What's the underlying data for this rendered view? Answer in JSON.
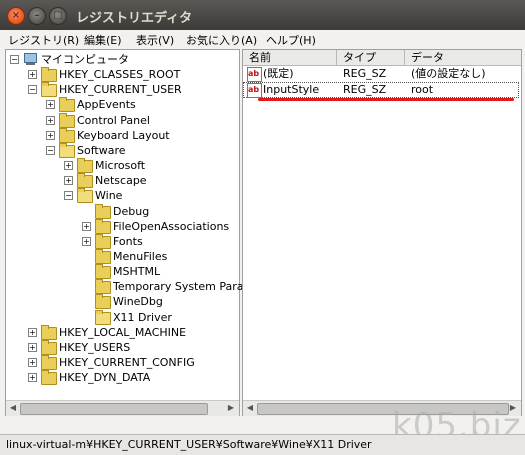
{
  "window": {
    "title": "レジストリエディタ"
  },
  "menubar": [
    "レジストリ(R)",
    "編集(E)",
    "表示(V)",
    "お気に入り(A)",
    "ヘルプ(H)"
  ],
  "tree": [
    {
      "label": "マイコンピュータ",
      "depth": 0,
      "icon": "computer-icon",
      "expander": "-"
    },
    {
      "label": "HKEY_CLASSES_ROOT",
      "depth": 1,
      "icon": "folder-icon",
      "expander": "+"
    },
    {
      "label": "HKEY_CURRENT_USER",
      "depth": 1,
      "icon": "folder-open-icon",
      "expander": "-"
    },
    {
      "label": "AppEvents",
      "depth": 2,
      "icon": "folder-icon",
      "expander": "+"
    },
    {
      "label": "Control Panel",
      "depth": 2,
      "icon": "folder-icon",
      "expander": "+"
    },
    {
      "label": "Keyboard Layout",
      "depth": 2,
      "icon": "folder-icon",
      "expander": "+"
    },
    {
      "label": "Software",
      "depth": 2,
      "icon": "folder-open-icon",
      "expander": "-"
    },
    {
      "label": "Microsoft",
      "depth": 3,
      "icon": "folder-icon",
      "expander": "+"
    },
    {
      "label": "Netscape",
      "depth": 3,
      "icon": "folder-icon",
      "expander": "+"
    },
    {
      "label": "Wine",
      "depth": 3,
      "icon": "folder-open-icon",
      "expander": "-"
    },
    {
      "label": "Debug",
      "depth": 4,
      "icon": "folder-icon",
      "expander": ""
    },
    {
      "label": "FileOpenAssociations",
      "depth": 4,
      "icon": "folder-icon",
      "expander": "+"
    },
    {
      "label": "Fonts",
      "depth": 4,
      "icon": "folder-icon",
      "expander": "+"
    },
    {
      "label": "MenuFiles",
      "depth": 4,
      "icon": "folder-icon",
      "expander": ""
    },
    {
      "label": "MSHTML",
      "depth": 4,
      "icon": "folder-icon",
      "expander": ""
    },
    {
      "label": "Temporary System Para",
      "depth": 4,
      "icon": "folder-icon",
      "expander": ""
    },
    {
      "label": "WineDbg",
      "depth": 4,
      "icon": "folder-icon",
      "expander": ""
    },
    {
      "label": "X11 Driver",
      "depth": 4,
      "icon": "folder-open-icon",
      "expander": ""
    },
    {
      "label": "HKEY_LOCAL_MACHINE",
      "depth": 1,
      "icon": "folder-icon",
      "expander": "+"
    },
    {
      "label": "HKEY_USERS",
      "depth": 1,
      "icon": "folder-icon",
      "expander": "+"
    },
    {
      "label": "HKEY_CURRENT_CONFIG",
      "depth": 1,
      "icon": "folder-icon",
      "expander": "+"
    },
    {
      "label": "HKEY_DYN_DATA",
      "depth": 1,
      "icon": "folder-icon",
      "expander": "+"
    }
  ],
  "list": {
    "columns": [
      "名前",
      "タイプ",
      "データ"
    ],
    "rows": [
      {
        "name": "(既定)",
        "type": "REG_SZ",
        "data": "(値の設定なし)",
        "icon": "string-value-icon"
      },
      {
        "name": "InputStyle",
        "type": "REG_SZ",
        "data": "root",
        "icon": "string-value-icon"
      }
    ]
  },
  "statusbar": "linux-virtual-m¥HKEY_CURRENT_USER¥Software¥Wine¥X11 Driver",
  "watermark": "k05.biz",
  "colors": {
    "titlebar": "#3c3b37",
    "highlight_line": "#e01a1a",
    "folder": "#e9cf5a"
  }
}
